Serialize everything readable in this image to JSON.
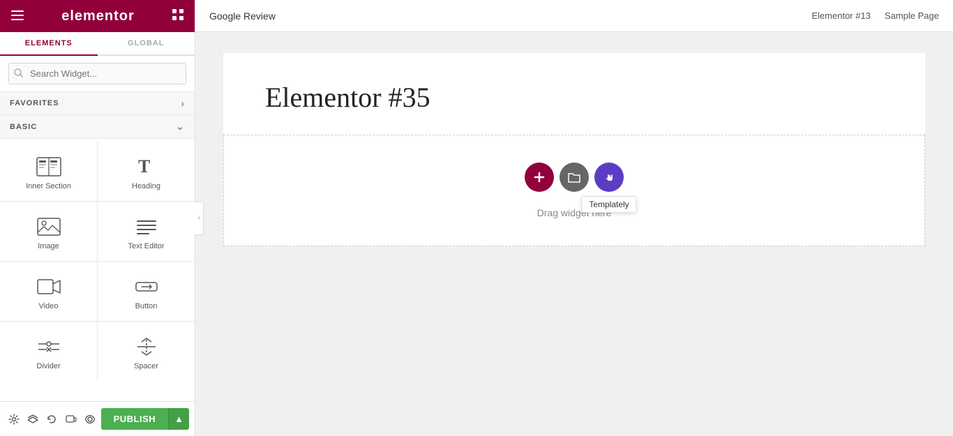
{
  "sidebar": {
    "logo": "elementor",
    "tabs": [
      {
        "id": "elements",
        "label": "ELEMENTS",
        "active": true
      },
      {
        "id": "global",
        "label": "GLOBAL",
        "active": false
      }
    ],
    "search": {
      "placeholder": "Search Widget...",
      "value": ""
    },
    "favorites_label": "FAVORITES",
    "basic_label": "BASIC",
    "widgets": [
      {
        "id": "inner-section",
        "label": "Inner Section",
        "icon": "inner-section-icon"
      },
      {
        "id": "heading",
        "label": "Heading",
        "icon": "heading-icon"
      },
      {
        "id": "image",
        "label": "Image",
        "icon": "image-icon"
      },
      {
        "id": "text-editor",
        "label": "Text Editor",
        "icon": "text-editor-icon"
      },
      {
        "id": "video",
        "label": "Video",
        "icon": "video-icon"
      },
      {
        "id": "button",
        "label": "Button",
        "icon": "button-icon"
      },
      {
        "id": "divider",
        "label": "Divider",
        "icon": "divider-icon"
      },
      {
        "id": "spacer",
        "label": "Spacer",
        "icon": "spacer-icon"
      }
    ],
    "footer": {
      "icons": [
        {
          "id": "settings",
          "label": "Settings"
        },
        {
          "id": "layers",
          "label": "Layers"
        },
        {
          "id": "history",
          "label": "History"
        },
        {
          "id": "responsive",
          "label": "Responsive"
        },
        {
          "id": "eye",
          "label": "Preview"
        }
      ],
      "publish_label": "PUBLISH",
      "publish_arrow": "▲"
    }
  },
  "topbar": {
    "page_name": "Google Review",
    "links": [
      {
        "id": "elementor-13",
        "label": "Elementor #13"
      },
      {
        "id": "sample-page",
        "label": "Sample Page"
      }
    ]
  },
  "canvas": {
    "page_title": "Elementor #35",
    "dropzone": {
      "hint": "Drag widget here",
      "add_tooltip": "+",
      "folder_tooltip": "",
      "templately_tooltip": "Templately"
    }
  }
}
